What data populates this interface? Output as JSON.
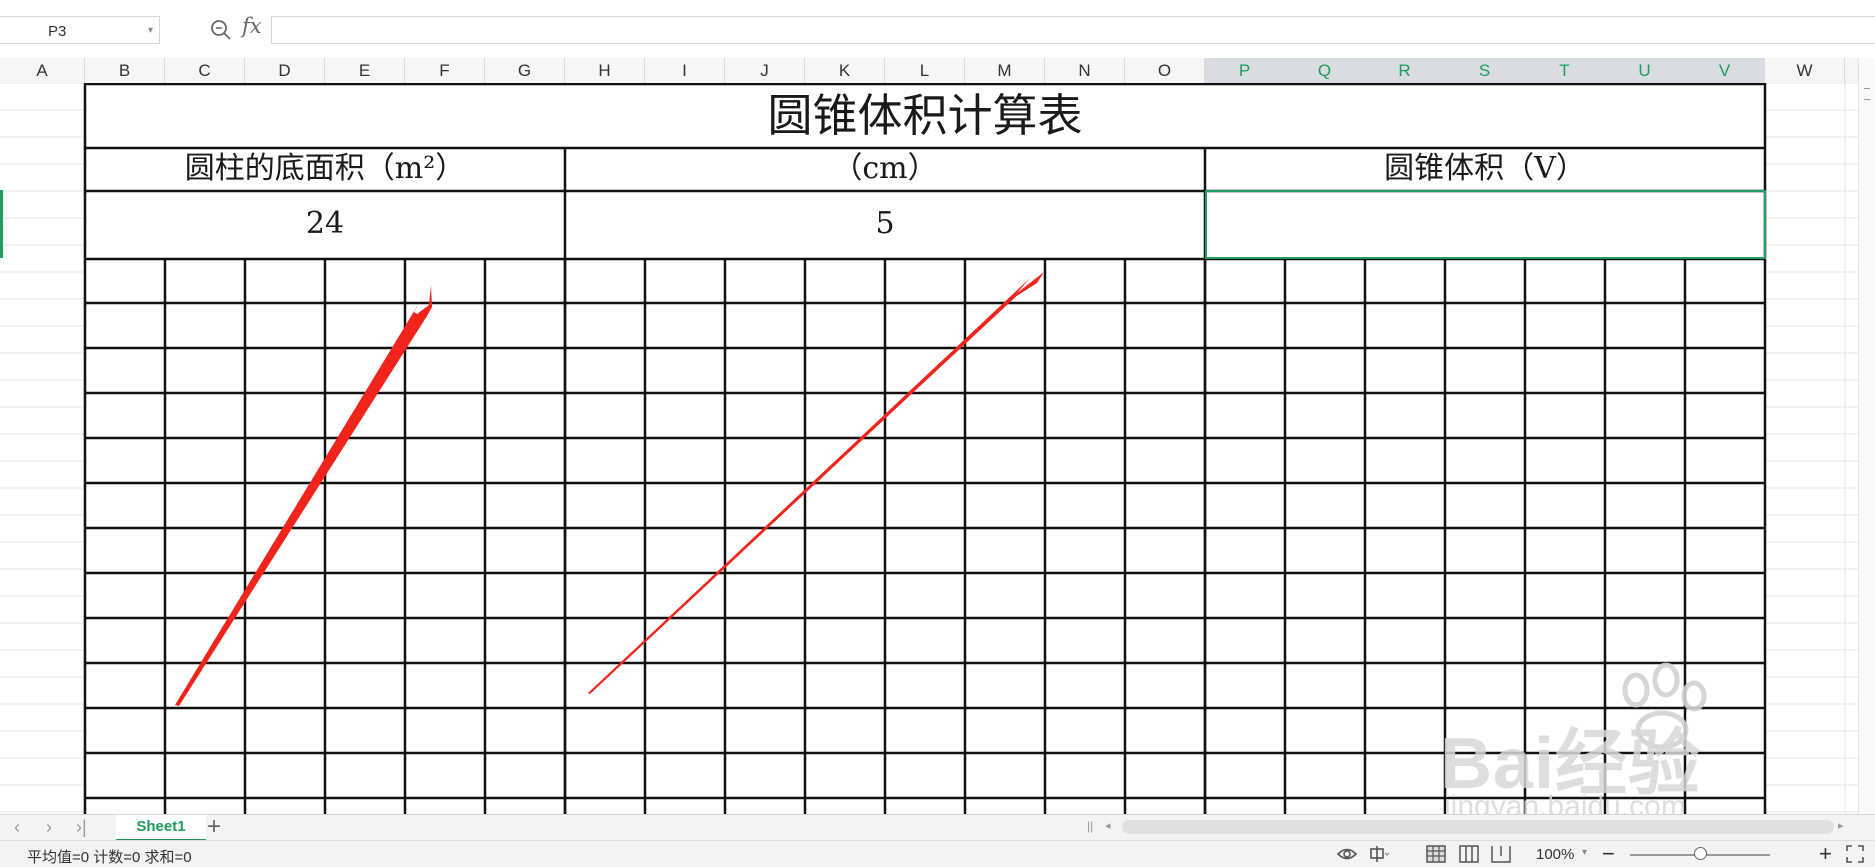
{
  "formula_bar": {
    "name_box_value": "P3",
    "fx_label": "fx",
    "formula_value": ""
  },
  "columns": [
    "A",
    "B",
    "C",
    "D",
    "E",
    "F",
    "G",
    "H",
    "I",
    "J",
    "K",
    "L",
    "M",
    "N",
    "O",
    "P",
    "Q",
    "R",
    "S",
    "T",
    "U",
    "V",
    "W"
  ],
  "selected_columns": [
    "P",
    "Q",
    "R",
    "S",
    "T",
    "U",
    "V"
  ],
  "sheet": {
    "title": "圆锥体积计算表",
    "headers": [
      "圆柱的底面积（m²）",
      "（cm）",
      "圆锥体积（V）"
    ],
    "values": [
      "24",
      "5",
      ""
    ]
  },
  "selection": {
    "cell": "P3",
    "color": "#20a060"
  },
  "annotation_color": "#f0241a",
  "watermark": {
    "brand": "Bai经验",
    "url": "jingyan.baidu.com"
  },
  "tabs": {
    "active_sheet": "Sheet1",
    "add_label": "+"
  },
  "status_bar": {
    "summary": "平均值=0  计数=0  求和=0",
    "zoom_level": "100%",
    "zoom_fraction": 0.5
  },
  "icons": {
    "zoom_formula": "magnifier-icon",
    "prev": "chevron-left-icon",
    "next": "chevron-right-icon",
    "last": "chevron-last-icon",
    "eye": "eye-protection-icon",
    "layout": "center-layout-icon",
    "normal_view": "grid-view-icon",
    "page_layout": "page-layout-icon",
    "page_break": "page-break-icon",
    "fullscreen": "fullscreen-icon"
  }
}
